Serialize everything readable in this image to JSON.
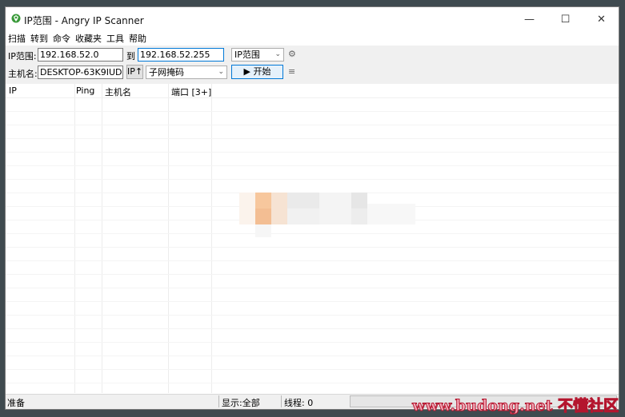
{
  "window": {
    "title": "IP范围 - Angry IP Scanner",
    "minimize": "—",
    "maximize": "☐",
    "close": "✕"
  },
  "menu": [
    "扫描",
    "转到",
    "命令",
    "收藏夹",
    "工具",
    "帮助"
  ],
  "toolbar": {
    "ip_range_label": "IP范围:",
    "ip_start": "192.168.52.0",
    "to_label": "到",
    "ip_end": "192.168.52.255",
    "feeder_select": "IP范围",
    "hostname_label": "主机名:",
    "hostname_value": "DESKTOP-63K9IUD",
    "ip_up_button": "IP↑",
    "netmask_select": "子网掩码",
    "start_button": "▶ 开始",
    "settings_icon": "gear-icon",
    "fetchers_icon": "list-icon"
  },
  "table": {
    "columns": [
      "IP",
      "Ping",
      "主机名",
      "端口 [3+]"
    ]
  },
  "status": {
    "ready": "准备",
    "display": "显示:全部",
    "threads": "线程: 0",
    "progress": 0
  },
  "watermark": "www.budong.net 不懂社区"
}
